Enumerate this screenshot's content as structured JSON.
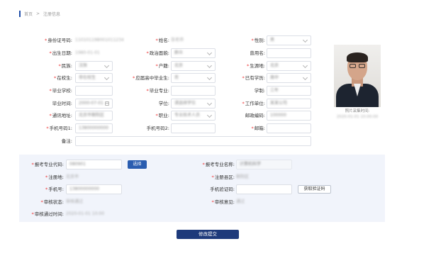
{
  "breadcrumb": {
    "home": "首页",
    "separator": ">",
    "current": "注册信息"
  },
  "form": {
    "id_number": {
      "label": "身份证号码:",
      "value": "110101198001011234"
    },
    "name": {
      "label": "姓名:",
      "value": "张老师"
    },
    "gender": {
      "label": "性别:",
      "value": "男"
    },
    "birth_date": {
      "label": "出生日期:",
      "value": "1980-01-01"
    },
    "political_status": {
      "label": "政治面貌:",
      "value": "群众"
    },
    "former_name": {
      "label": "曾用名:",
      "value": ""
    },
    "ethnicity": {
      "label": "民族:",
      "value": "汉族"
    },
    "hukou": {
      "label": "户籍:",
      "value": "北京"
    },
    "origin": {
      "label": "生源地:",
      "value": "北京"
    },
    "in_school": {
      "label": "在校生:",
      "value": "非在校生"
    },
    "hs_graduate": {
      "label": "应届高中毕业生:",
      "value": "否"
    },
    "education": {
      "label": "已有学历:",
      "value": "高中"
    },
    "grad_school": {
      "label": "毕业学校:",
      "value": ""
    },
    "grad_major": {
      "label": "毕业专业:",
      "value": ""
    },
    "degree": {
      "label": "学制:",
      "value": "三年"
    },
    "grad_time": {
      "label": "毕业时间:",
      "value": "2000-07-01"
    },
    "degree2": {
      "label": "学位:",
      "value": "请选择学位"
    },
    "employer": {
      "label": "工作单位:",
      "value": "某某公司"
    },
    "address": {
      "label": "通讯地址:",
      "value": "北京市朝阳区"
    },
    "occupation": {
      "label": "职业:",
      "value": "专业技术人员"
    },
    "postcode": {
      "label": "邮政编码:",
      "value": "100000"
    },
    "mobile1": {
      "label": "手机号码1:",
      "value": "13800000000"
    },
    "mobile2": {
      "label": "手机号码2:",
      "value": ""
    },
    "email": {
      "label": "邮箱:",
      "value": ""
    },
    "remark": {
      "label": "备注:",
      "value": ""
    }
  },
  "photo": {
    "caption": "照片采集时间:",
    "date": "2020-01-01 10:00:00"
  },
  "apply": {
    "major_code": {
      "label": "报考专业代码:",
      "value": "080901"
    },
    "select_button": "选择",
    "major_name": {
      "label": "报考专业名称:",
      "value": "计算机科学"
    },
    "reg_site": {
      "label": "注册地:",
      "value": "北京市"
    },
    "reg_district": {
      "label": "注册县区:",
      "value": "朝阳区"
    },
    "phone": {
      "label": "手机号:",
      "value": "13800000000"
    },
    "verify_code": {
      "label": "手机验证码:",
      "value": ""
    },
    "get_code_button": "获取验证码",
    "audit_status": {
      "label": "审核状态:",
      "value": "审核通过"
    },
    "audit_opinion": {
      "label": "审核意见:",
      "value": "通过"
    },
    "audit_time": {
      "label": "审核通过时间:",
      "value": "2020-01-01 10:00"
    }
  },
  "submit_button": "修改提交"
}
